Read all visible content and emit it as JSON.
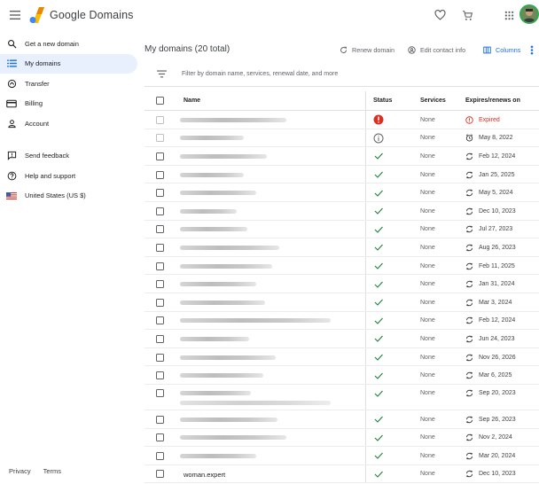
{
  "app": {
    "brand": "Google Domains"
  },
  "sidebar": {
    "items": [
      {
        "label": "Get a new domain",
        "icon": "search-icon"
      },
      {
        "label": "My domains",
        "icon": "list-icon",
        "active": true
      },
      {
        "label": "Transfer",
        "icon": "transfer-icon"
      },
      {
        "label": "Billing",
        "icon": "credit-card-icon"
      },
      {
        "label": "Account",
        "icon": "account-icon"
      }
    ],
    "secondary": [
      {
        "label": "Send feedback",
        "icon": "feedback-icon"
      },
      {
        "label": "Help and support",
        "icon": "help-icon"
      },
      {
        "label": "United States (US $)",
        "icon": "us-flag-icon"
      }
    ],
    "footer": {
      "privacy": "Privacy",
      "terms": "Terms"
    }
  },
  "main": {
    "title": "My domains (20 total)",
    "actions": {
      "renew": "Renew domain",
      "edit_contact": "Edit contact info",
      "columns": "Columns"
    },
    "filter_placeholder": "Filter by domain name, services, renewal date, and more",
    "columns": {
      "name": "Name",
      "status": "Status",
      "services": "Services",
      "expires": "Expires/renews on"
    },
    "rows": [
      {
        "name": "",
        "blur": 120,
        "status": "error",
        "services": "None",
        "exp_icon": "expired",
        "expires": "Expired",
        "disabled": true
      },
      {
        "name": "",
        "blur": 72,
        "status": "info",
        "services": "None",
        "exp_icon": "alarm",
        "expires": "May 8, 2022",
        "disabled": true
      },
      {
        "name": "",
        "blur": 98,
        "status": "ok",
        "services": "None",
        "exp_icon": "renew",
        "expires": "Feb 12, 2024"
      },
      {
        "name": "",
        "blur": 72,
        "status": "ok",
        "services": "None",
        "exp_icon": "renew",
        "expires": "Jan 25, 2025"
      },
      {
        "name": "",
        "blur": 86,
        "status": "ok",
        "services": "None",
        "exp_icon": "renew",
        "expires": "May 5, 2024"
      },
      {
        "name": "",
        "blur": 64,
        "status": "ok",
        "services": "None",
        "exp_icon": "renew",
        "expires": "Dec 10, 2023"
      },
      {
        "name": "",
        "blur": 76,
        "status": "ok",
        "services": "None",
        "exp_icon": "renew",
        "expires": "Jul 27, 2023"
      },
      {
        "name": "",
        "blur": 112,
        "status": "ok",
        "services": "None",
        "exp_icon": "renew",
        "expires": "Aug 26, 2023"
      },
      {
        "name": "",
        "blur": 104,
        "status": "ok",
        "services": "None",
        "exp_icon": "renew",
        "expires": "Feb 11, 2025"
      },
      {
        "name": "",
        "blur": 86,
        "status": "ok",
        "services": "None",
        "exp_icon": "renew",
        "expires": "Jan 31, 2024"
      },
      {
        "name": "",
        "blur": 96,
        "status": "ok",
        "services": "None",
        "exp_icon": "renew",
        "expires": "Mar 3, 2024"
      },
      {
        "name": "",
        "blur": 170,
        "status": "ok",
        "services": "None",
        "exp_icon": "renew",
        "expires": "Feb 12, 2024"
      },
      {
        "name": "",
        "blur": 78,
        "status": "ok",
        "services": "None",
        "exp_icon": "renew",
        "expires": "Jun 24, 2023"
      },
      {
        "name": "",
        "blur": 108,
        "status": "ok",
        "services": "None",
        "exp_icon": "renew",
        "expires": "Nov 26, 2026"
      },
      {
        "name": "",
        "blur": 94,
        "status": "ok",
        "services": "None",
        "exp_icon": "renew",
        "expires": "Mar 6, 2025"
      },
      {
        "name": "",
        "blur": 80,
        "status": "ok",
        "services": "None",
        "exp_icon": "renew",
        "expires": "Sep 20, 2023",
        "tall": true
      },
      {
        "name": "",
        "blur": 110,
        "status": "ok",
        "services": "None",
        "exp_icon": "renew",
        "expires": "Sep 26, 2023"
      },
      {
        "name": "",
        "blur": 120,
        "status": "ok",
        "services": "None",
        "exp_icon": "renew",
        "expires": "Nov 2, 2024"
      },
      {
        "name": "",
        "blur": 86,
        "status": "ok",
        "services": "None",
        "exp_icon": "renew",
        "expires": "Mar 20, 2024"
      },
      {
        "name": "woman.expert",
        "blur": 0,
        "status": "ok",
        "services": "None",
        "exp_icon": "renew",
        "expires": "Dec 10, 2023"
      }
    ]
  },
  "colors": {
    "accent": "#1a73e8",
    "active_bg": "#e8f0fe",
    "ok": "#188038",
    "error": "#d93025"
  }
}
